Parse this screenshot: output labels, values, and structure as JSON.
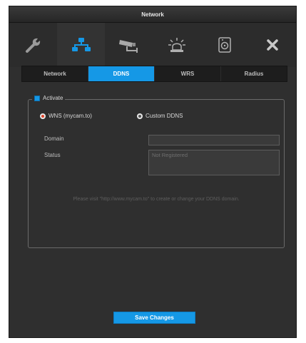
{
  "window": {
    "title": "Network"
  },
  "toolbar_icons": [
    {
      "name": "wrench-icon"
    },
    {
      "name": "network-icon",
      "active": true
    },
    {
      "name": "camera-icon"
    },
    {
      "name": "alarm-icon"
    },
    {
      "name": "storage-icon"
    },
    {
      "name": "close-icon"
    }
  ],
  "tabs": [
    {
      "label": "Network"
    },
    {
      "label": "DDNS",
      "active": true
    },
    {
      "label": "WRS"
    },
    {
      "label": "Radius"
    }
  ],
  "ddns": {
    "activate_label": "Activate",
    "activate_checked": true,
    "options": [
      {
        "label": "WNS (mycam.to)",
        "selected": true
      },
      {
        "label": "Custom DDNS",
        "selected": false
      }
    ],
    "domain_label": "Domain",
    "domain_value": "",
    "status_label": "Status",
    "status_value": "Not Registered",
    "hint": "Please visit \"http://www.mycam.to\" to create or change your DDNS domain."
  },
  "footer": {
    "save_label": "Save Changes"
  },
  "colors": {
    "accent": "#1598e6",
    "background": "#2f2f2f",
    "radio_selected": "#e0442a"
  }
}
